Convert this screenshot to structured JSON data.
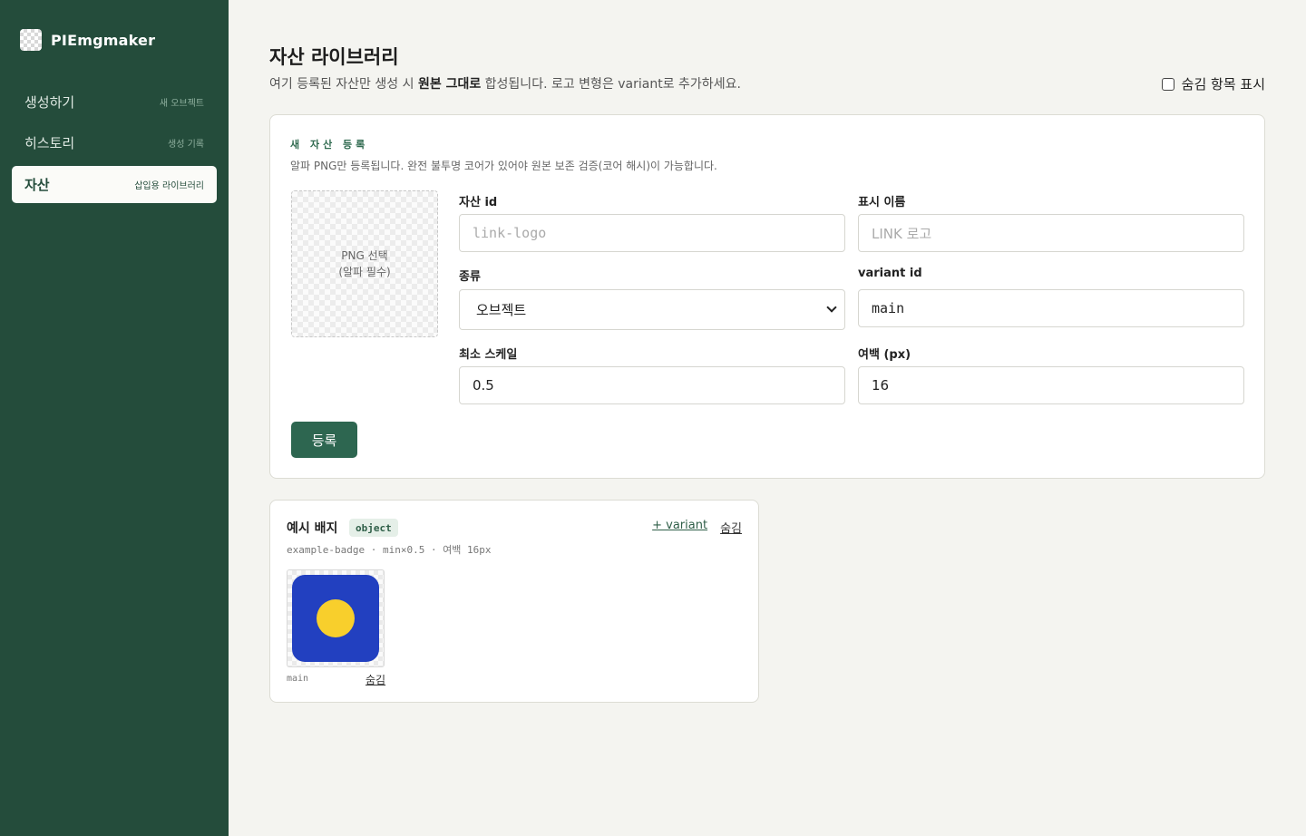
{
  "app": {
    "name": "PIEmgmaker"
  },
  "sidebar": {
    "items": [
      {
        "label": "생성하기",
        "sub": "새 오브젝트"
      },
      {
        "label": "히스토리",
        "sub": "생성 기록"
      },
      {
        "label": "자산",
        "sub": "삽입용 라이브러리",
        "active": true
      }
    ]
  },
  "header": {
    "title": "자산 라이브러리",
    "desc_before": "여기 등록된 자산만 생성 시 ",
    "desc_bold": "원본 그대로",
    "desc_after": " 합성됩니다. 로고 변형은 variant로 추가하세요.",
    "show_hidden_label": "숨김 항목 표시",
    "show_hidden_checked": false
  },
  "register": {
    "title": "새 자산 등록",
    "desc": "알파 PNG만 등록됩니다. 완전 불투명 코어가 있어야 원본 보존 검증(코어 해시)이 가능합니다.",
    "drop_line1": "PNG 선택",
    "drop_line2": "(알파 필수)",
    "fields": {
      "asset_id": {
        "label": "자산 id",
        "placeholder": "link-logo",
        "value": ""
      },
      "display_name": {
        "label": "표시 이름",
        "placeholder": "LINK 로고",
        "value": ""
      },
      "kind": {
        "label": "종류",
        "value": "오브젝트"
      },
      "variant_id": {
        "label": "variant id",
        "value": "main"
      },
      "min_scale": {
        "label": "최소 스케일",
        "value": "0.5"
      },
      "padding": {
        "label": "여백 (px)",
        "value": "16"
      }
    },
    "submit_label": "등록"
  },
  "assets": [
    {
      "name": "예시 배지",
      "type_badge": "object",
      "meta": "example-badge · min×0.5 · 여백 16px",
      "add_variant_label": "+ variant",
      "hide_label": "숨김",
      "variants": [
        {
          "id": "main",
          "hide_label": "숨김",
          "bg_color": "#2240c0",
          "dot_color": "#f8cf2c"
        }
      ]
    }
  ]
}
